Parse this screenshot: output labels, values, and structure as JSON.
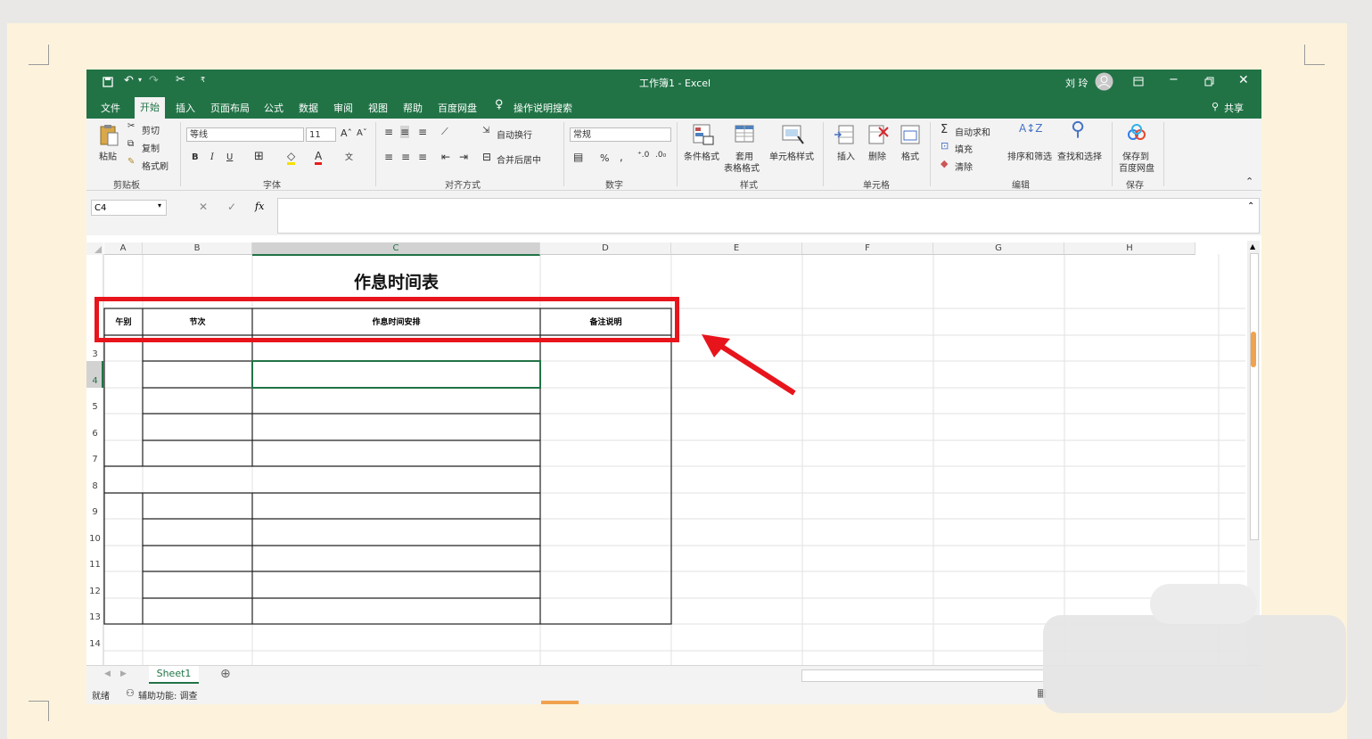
{
  "titlebar": {
    "title": "工作簿1 - Excel",
    "user": "刘 玲",
    "qat_more": "₹"
  },
  "menu": {
    "tabs": [
      "文件",
      "开始",
      "插入",
      "页面布局",
      "公式",
      "数据",
      "审阅",
      "视图",
      "帮助",
      "百度网盘"
    ],
    "tell_me": "操作说明搜索",
    "share": "共享"
  },
  "ribbon": {
    "clipboard": {
      "paste": "粘贴",
      "cut": "剪切",
      "copy": "复制",
      "format_painter": "格式刷",
      "group": "剪贴板"
    },
    "font": {
      "name": "等线",
      "size": "11",
      "bold": "B",
      "italic": "I",
      "underline": "U",
      "group": "字体"
    },
    "alignment": {
      "wrap": "自动换行",
      "merge": "合并后居中",
      "group": "对齐方式"
    },
    "number": {
      "format": "常规",
      "percent": "%",
      "comma": ",",
      "group": "数字"
    },
    "styles": {
      "conditional": "条件格式",
      "table_l1": "套用",
      "table_l2": "表格格式",
      "cell_styles": "单元格样式",
      "group": "样式"
    },
    "cells": {
      "insert": "插入",
      "delete": "删除",
      "format": "格式",
      "group": "单元格"
    },
    "editing": {
      "autosum": "自动求和",
      "fill": "填充",
      "clear": "清除",
      "sort": "排序和筛选",
      "find": "查找和选择",
      "group": "编辑"
    },
    "save": {
      "l1": "保存到",
      "l2": "百度网盘",
      "group": "保存"
    }
  },
  "formula_bar": {
    "name_box": "C4",
    "fx": "fx",
    "content": ""
  },
  "columns": [
    "A",
    "B",
    "C",
    "D",
    "E",
    "F",
    "G",
    "H"
  ],
  "rows": [
    "3",
    "4",
    "5",
    "6",
    "7",
    "8",
    "9",
    "10",
    "11",
    "12",
    "13",
    "14"
  ],
  "sheet": {
    "title": "作息时间表",
    "headers": [
      "午别",
      "节次",
      "作息时间安排",
      "备注说明"
    ]
  },
  "sheet_tabs": [
    "Sheet1"
  ],
  "status": {
    "ready": "就绪",
    "accessibility": "辅助功能: 调查"
  },
  "colors": {
    "excel_green": "#217346",
    "highlight_red": "#e8141c"
  }
}
